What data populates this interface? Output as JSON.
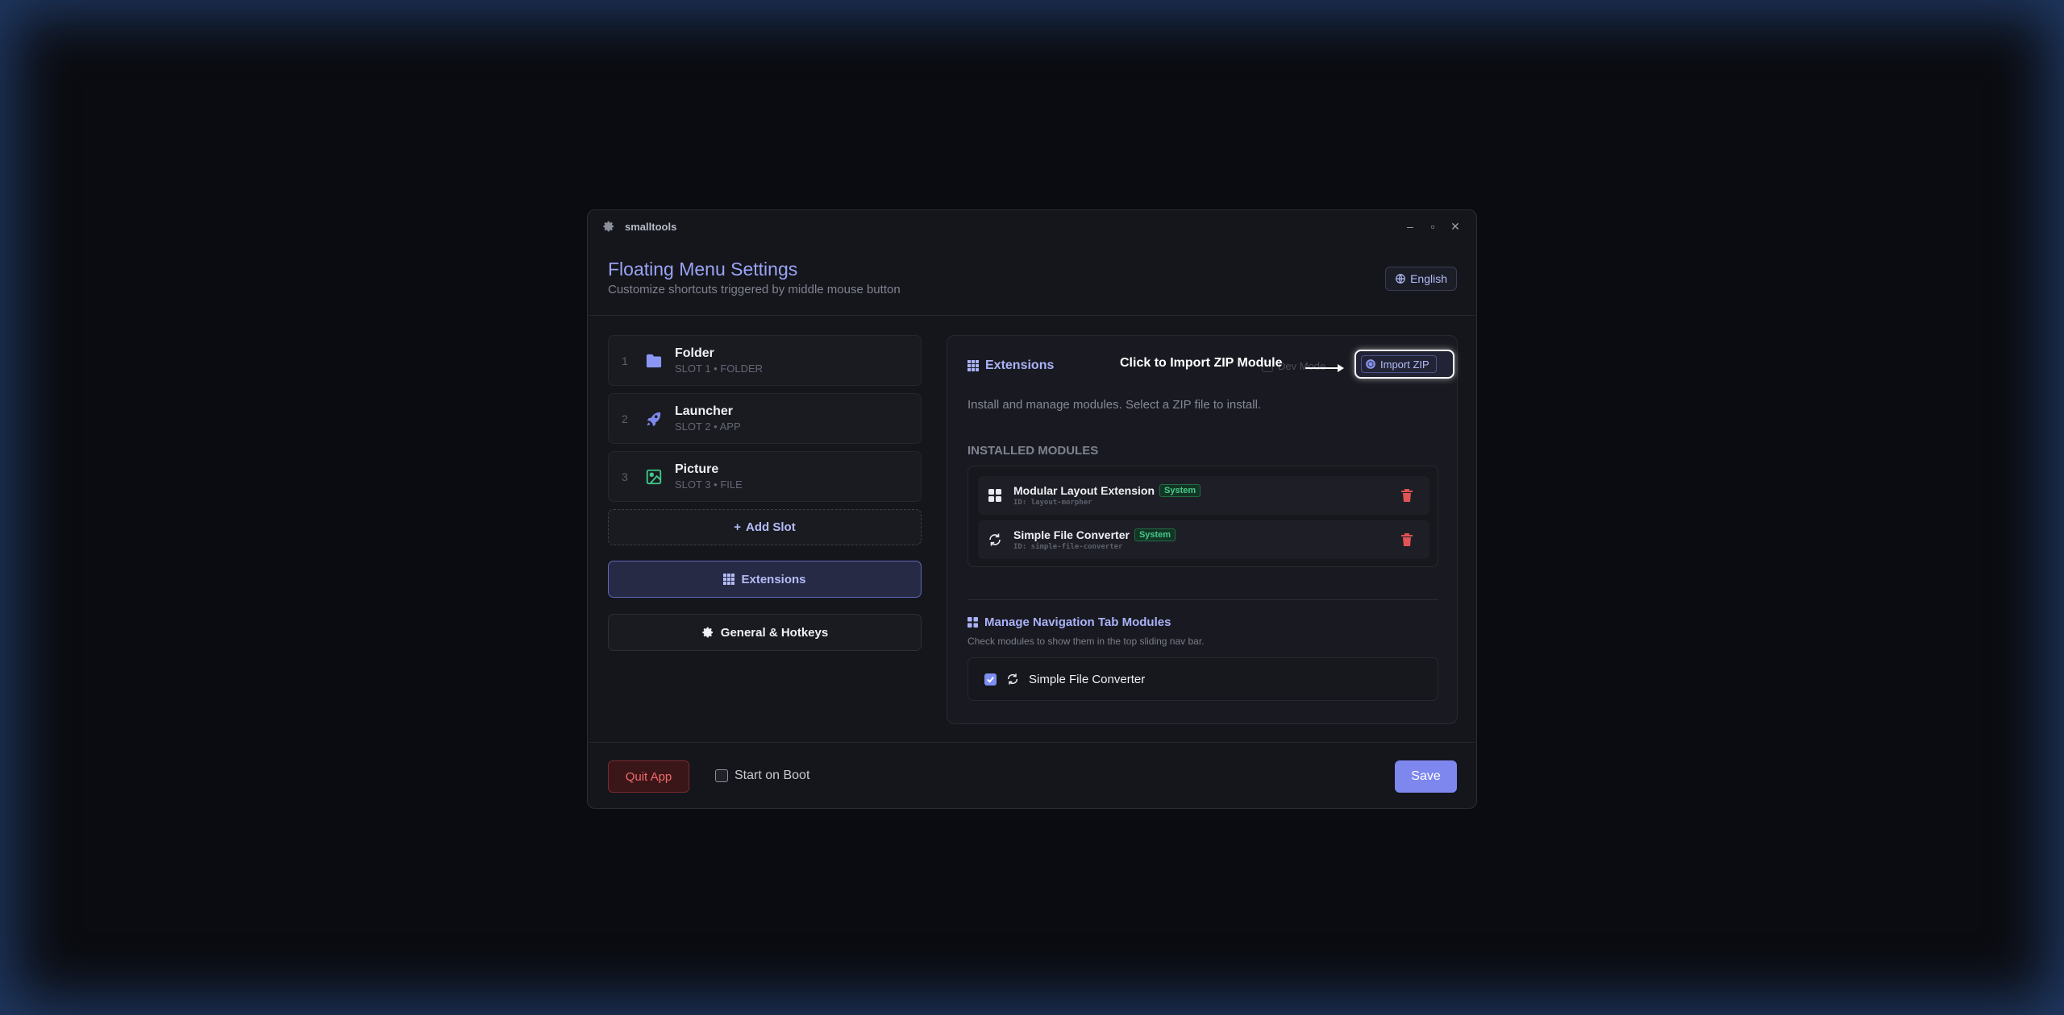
{
  "window": {
    "app_title": "smalltools",
    "controls": {
      "minimize": "–",
      "maximize": "▫",
      "close": "✕"
    }
  },
  "header": {
    "title": "Floating Menu Settings",
    "subtitle": "Customize shortcuts triggered by middle mouse button",
    "language": "English"
  },
  "sidebar": {
    "slots": [
      {
        "num": "1",
        "name": "Folder",
        "sub": "SLOT 1 • FOLDER",
        "icon": "folder-icon",
        "color": "#8b97f3"
      },
      {
        "num": "2",
        "name": "Launcher",
        "sub": "SLOT 2 • APP",
        "icon": "rocket-icon",
        "color": "#7e87ea"
      },
      {
        "num": "3",
        "name": "Picture",
        "sub": "SLOT 3 • FILE",
        "icon": "image-icon",
        "color": "#3fc98a"
      }
    ],
    "add_slot": "Add Slot",
    "add_slot_glyph": "+",
    "nav": {
      "extensions": "Extensions",
      "general": "General & Hotkeys"
    }
  },
  "extensions": {
    "title": "Extensions",
    "callout": "Click to Import ZIP Module",
    "dev_mode": "Dev Mode",
    "import_zip": "Import ZIP",
    "description": "Install and manage modules. Select a ZIP file to install.",
    "installed_label": "INSTALLED MODULES",
    "modules": [
      {
        "name": "Modular Layout Extension",
        "badge": "System",
        "id": "ID: layout-morpher",
        "icon": "grid-icon"
      },
      {
        "name": "Simple File Converter",
        "badge": "System",
        "id": "ID: simple-file-converter",
        "icon": "refresh-icon"
      }
    ],
    "nav_modules": {
      "title": "Manage Navigation Tab Modules",
      "description": "Check modules to show them in the top sliding nav bar.",
      "items": [
        {
          "label": "Simple File Converter",
          "checked": true
        }
      ]
    }
  },
  "footer": {
    "quit": "Quit App",
    "start_on_boot": "Start on Boot",
    "start_on_boot_checked": false,
    "save": "Save"
  },
  "colors": {
    "accent": "#7d87ee",
    "danger": "#f26a6a",
    "success": "#47c98a",
    "background": "#0b0c11",
    "window": "#15161c"
  }
}
